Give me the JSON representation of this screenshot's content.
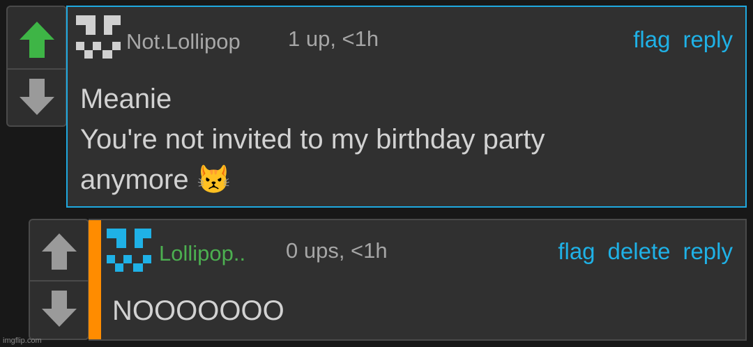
{
  "comments": [
    {
      "username": "Not.Lollipop",
      "meta": "1 up, <1h",
      "actions": [
        "flag",
        "reply"
      ],
      "body": "Meanie\nYou're not invited to my birthday party\nanymore",
      "emoji": "😾",
      "upvote_active": true,
      "username_color": "#a8a8a8"
    },
    {
      "username": "Lollipop..",
      "meta": "0 ups, <1h",
      "actions": [
        "flag",
        "delete",
        "reply"
      ],
      "body": "NOOOOOOO",
      "username_color": "#4caf50"
    }
  ],
  "watermark": "imgflip.com",
  "colors": {
    "accent_blue": "#1fb1e6",
    "upvote_green": "#3eb546",
    "op_bar_orange": "#ff8c00"
  }
}
